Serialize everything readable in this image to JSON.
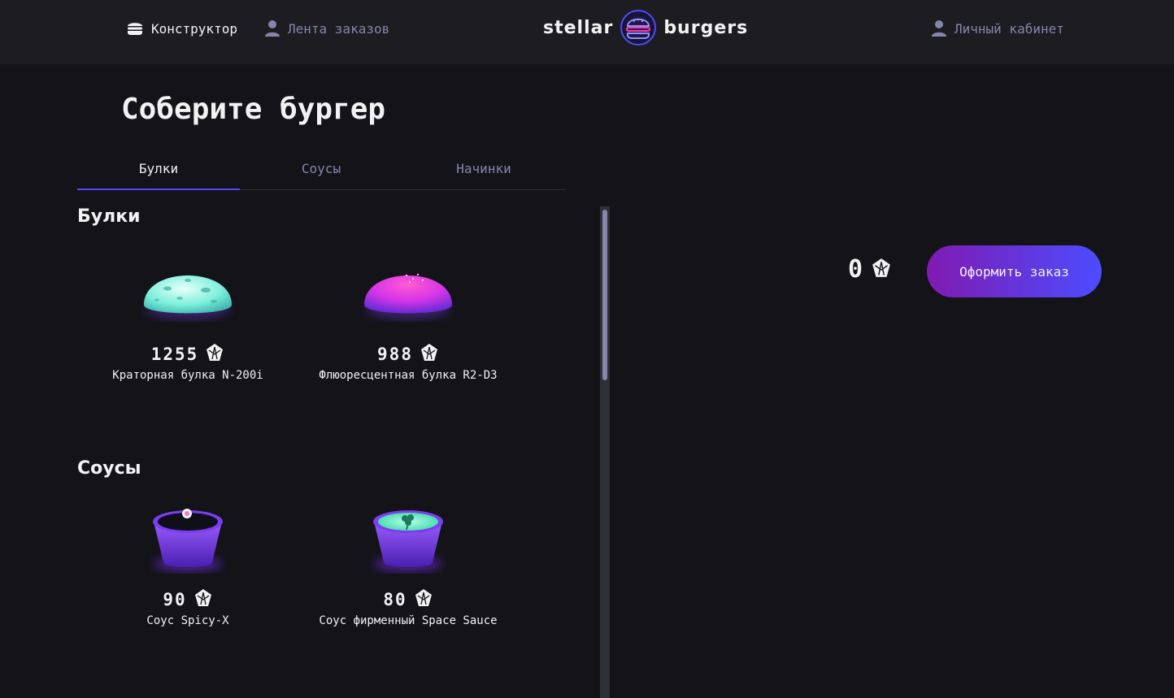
{
  "header": {
    "nav_constructor": "Конструктор",
    "nav_feed": "Лента заказов",
    "logo_left": "stellar",
    "logo_right": "burgers",
    "nav_profile": "Личный кабинет"
  },
  "main": {
    "title": "Соберите бургер",
    "tabs": [
      {
        "label": "Булки",
        "active": true
      },
      {
        "label": "Соусы",
        "active": false
      },
      {
        "label": "Начинки",
        "active": false
      }
    ],
    "sections": [
      {
        "title": "Булки",
        "items": [
          {
            "price": "1255",
            "name": "Краторная булка N-200i",
            "icon": "crater-bun-image"
          },
          {
            "price": "988",
            "name": "Флюоресцентная булка R2-D3",
            "icon": "fluorescent-bun-image"
          }
        ]
      },
      {
        "title": "Соусы",
        "items": [
          {
            "price": "90",
            "name": "Соус Spicy-X",
            "icon": "spicy-sauce-image"
          },
          {
            "price": "80",
            "name": "Соус фирменный Space Sauce",
            "icon": "space-sauce-image"
          }
        ]
      }
    ]
  },
  "order": {
    "total": "0",
    "button_label": "Оформить заказ"
  },
  "colors": {
    "background": "#131318",
    "header": "#1c1c21",
    "accent": "#4c4cff",
    "inactive_text": "#8585ad",
    "button_gradient_start": "#801ab2",
    "button_gradient_end": "#4c4cff"
  }
}
